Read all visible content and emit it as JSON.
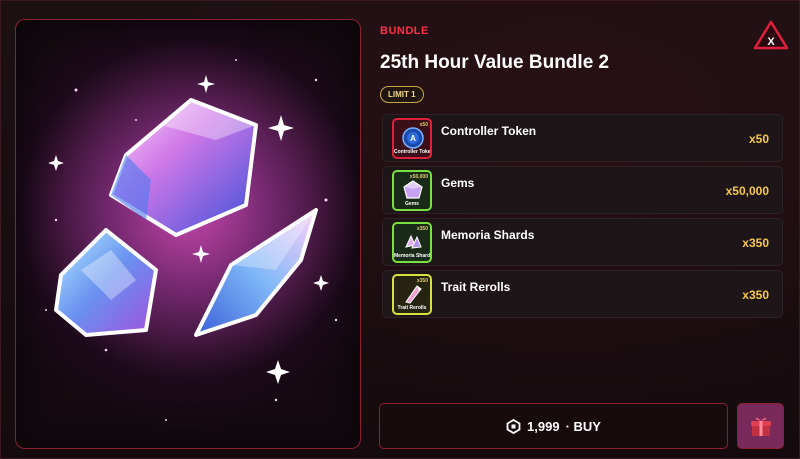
{
  "bundle": {
    "tag": "BUNDLE",
    "title": "25th Hour Value Bundle 2",
    "limit": "LIMIT 1"
  },
  "items": [
    {
      "name": "Controller Token",
      "amount": "x50",
      "thumb_qty": "x50",
      "thumb_caption": "Controller Token",
      "border": "#e0203a",
      "icon": "controller-token-icon"
    },
    {
      "name": "Gems",
      "amount": "x50,000",
      "thumb_qty": "x50,000",
      "thumb_caption": "Gems",
      "border": "#7ae040",
      "icon": "gem-icon"
    },
    {
      "name": "Memoria Shards",
      "amount": "x350",
      "thumb_qty": "x350",
      "thumb_caption": "Memoria Shards",
      "border": "#7ae040",
      "icon": "memoria-shard-icon"
    },
    {
      "name": "Trait Rerolls",
      "amount": "x350",
      "thumb_qty": "x350",
      "thumb_caption": "Trait Rerolls",
      "border": "#d8e040",
      "icon": "trait-reroll-icon"
    }
  ],
  "buy": {
    "price": "1,999",
    "label": "· BUY",
    "currency_icon": "robux-icon"
  },
  "gift": {
    "icon": "gift-icon"
  },
  "close": {
    "icon": "close-x-icon"
  },
  "colors": {
    "accent": "#ff3048",
    "gold": "#f5c84a",
    "border": "#8a2030"
  }
}
